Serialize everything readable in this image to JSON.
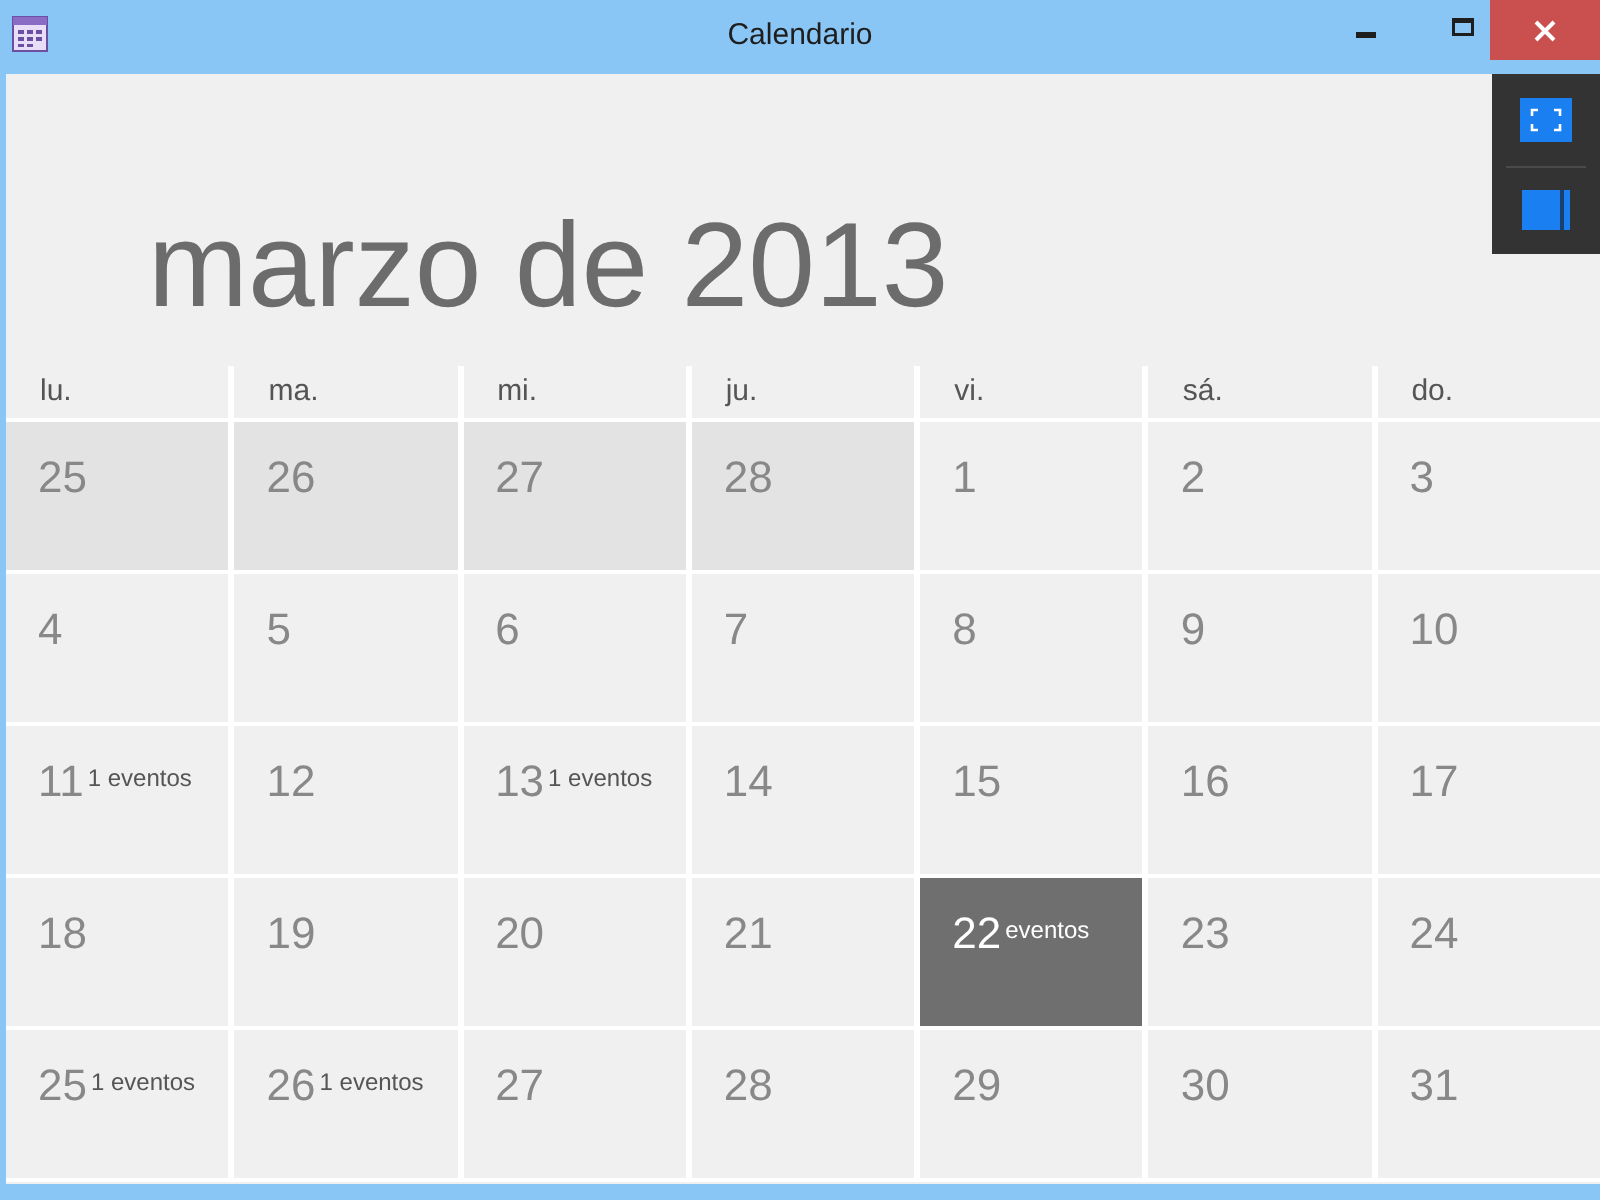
{
  "window": {
    "title": "Calendario"
  },
  "month_title": "marzo de 2013",
  "weekdays": [
    "lu.",
    "ma.",
    "mi.",
    "ju.",
    "vi.",
    "sá.",
    "do."
  ],
  "weeks": [
    [
      {
        "day": "25",
        "outside_month": true,
        "today": false
      },
      {
        "day": "26",
        "outside_month": true,
        "today": false
      },
      {
        "day": "27",
        "outside_month": true,
        "today": false
      },
      {
        "day": "28",
        "outside_month": true,
        "today": false
      },
      {
        "day": "1",
        "outside_month": false,
        "today": false
      },
      {
        "day": "2",
        "outside_month": false,
        "today": false
      },
      {
        "day": "3",
        "outside_month": false,
        "today": false
      }
    ],
    [
      {
        "day": "4",
        "outside_month": false,
        "today": false
      },
      {
        "day": "5",
        "outside_month": false,
        "today": false
      },
      {
        "day": "6",
        "outside_month": false,
        "today": false
      },
      {
        "day": "7",
        "outside_month": false,
        "today": false
      },
      {
        "day": "8",
        "outside_month": false,
        "today": false
      },
      {
        "day": "9",
        "outside_month": false,
        "today": false
      },
      {
        "day": "10",
        "outside_month": false,
        "today": false
      }
    ],
    [
      {
        "day": "11",
        "outside_month": false,
        "today": false,
        "events": "1 eventos"
      },
      {
        "day": "12",
        "outside_month": false,
        "today": false
      },
      {
        "day": "13",
        "outside_month": false,
        "today": false,
        "events": "1 eventos"
      },
      {
        "day": "14",
        "outside_month": false,
        "today": false
      },
      {
        "day": "15",
        "outside_month": false,
        "today": false
      },
      {
        "day": "16",
        "outside_month": false,
        "today": false
      },
      {
        "day": "17",
        "outside_month": false,
        "today": false
      }
    ],
    [
      {
        "day": "18",
        "outside_month": false,
        "today": false
      },
      {
        "day": "19",
        "outside_month": false,
        "today": false
      },
      {
        "day": "20",
        "outside_month": false,
        "today": false
      },
      {
        "day": "21",
        "outside_month": false,
        "today": false
      },
      {
        "day": "22",
        "outside_month": false,
        "today": true,
        "events": "eventos"
      },
      {
        "day": "23",
        "outside_month": false,
        "today": false
      },
      {
        "day": "24",
        "outside_month": false,
        "today": false
      }
    ],
    [
      {
        "day": "25",
        "outside_month": false,
        "today": false,
        "events": "1 eventos"
      },
      {
        "day": "26",
        "outside_month": false,
        "today": false,
        "events": "1 eventos"
      },
      {
        "day": "27",
        "outside_month": false,
        "today": false
      },
      {
        "day": "28",
        "outside_month": false,
        "today": false
      },
      {
        "day": "29",
        "outside_month": false,
        "today": false
      },
      {
        "day": "30",
        "outside_month": false,
        "today": false
      },
      {
        "day": "31",
        "outside_month": false,
        "today": false
      }
    ]
  ]
}
